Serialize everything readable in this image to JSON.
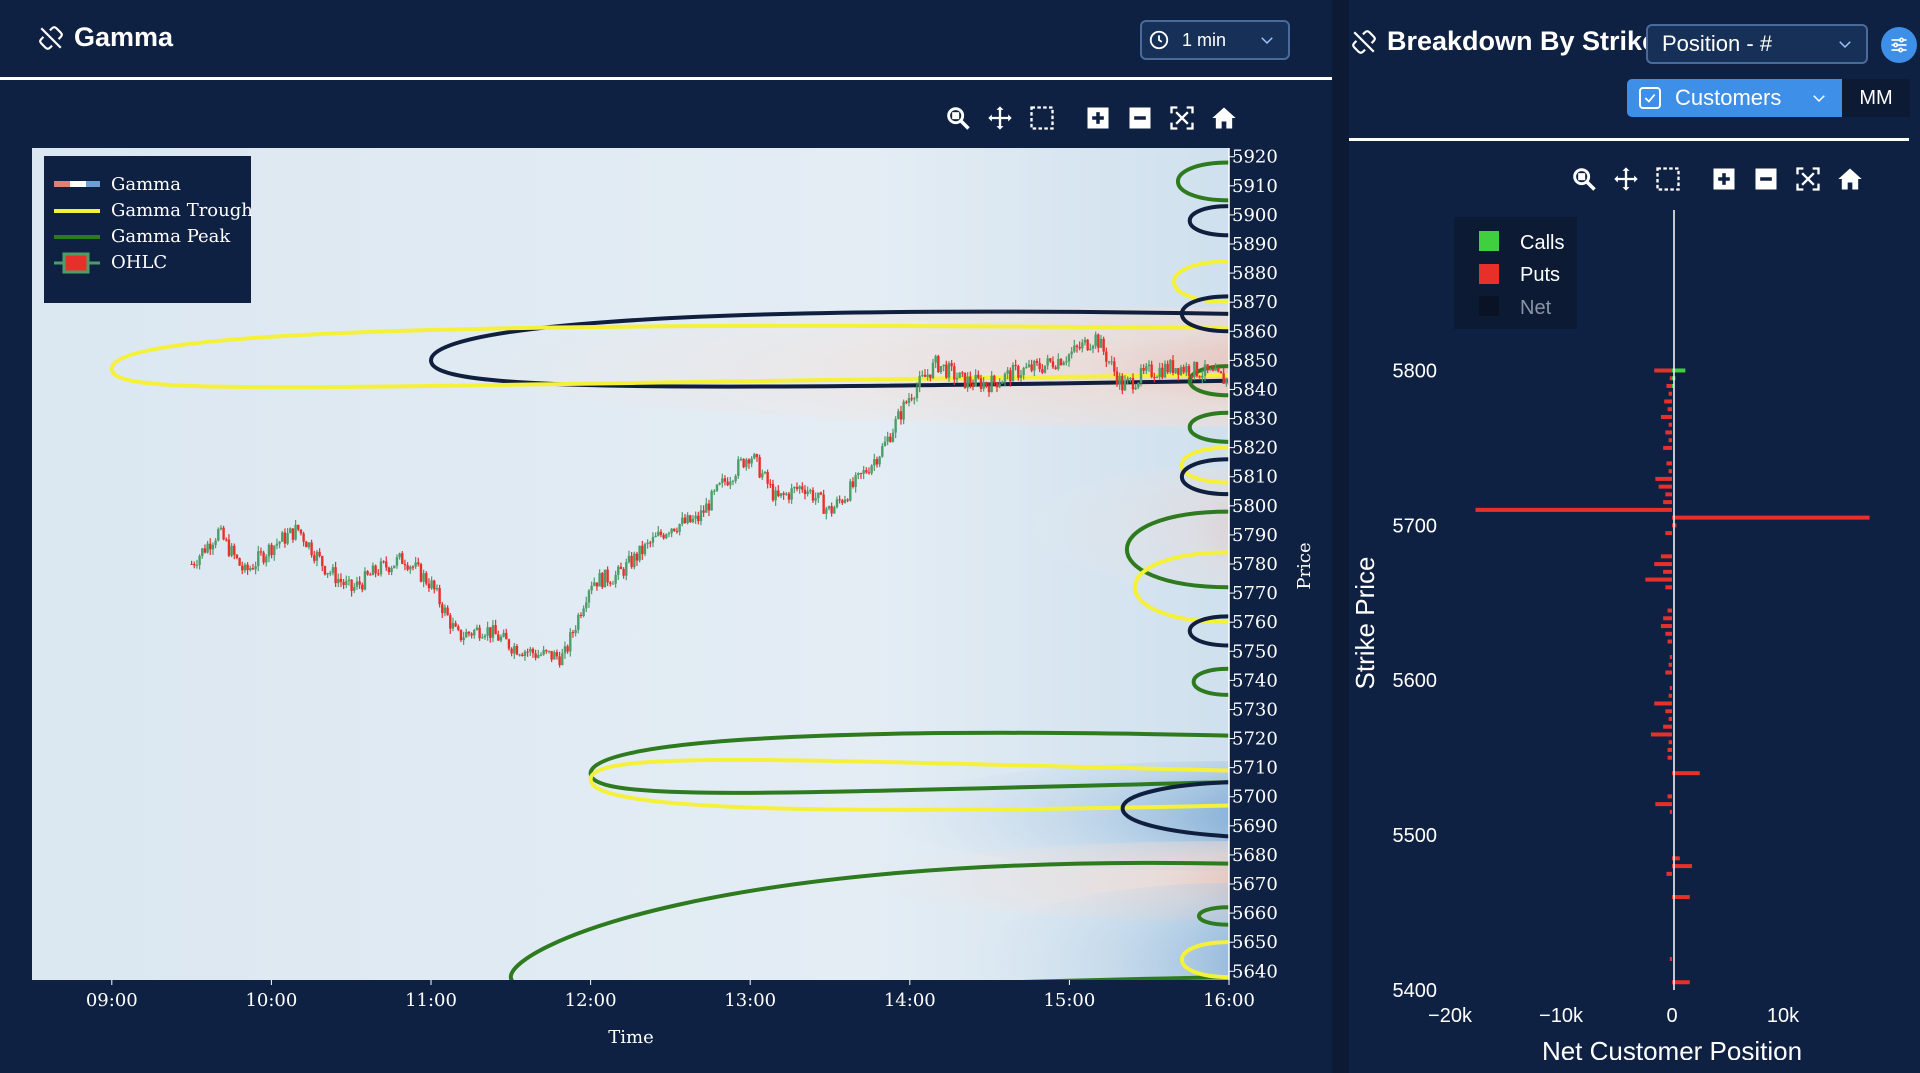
{
  "left": {
    "title": "Gamma",
    "interval": "1 min",
    "icons": [
      "zoom-icon",
      "pan-icon",
      "box-select-icon",
      "zoom-in-icon",
      "zoom-out-icon",
      "autoscale-icon",
      "home-icon"
    ]
  },
  "right": {
    "title": "Breakdown By Strike",
    "position_select": "Position - #",
    "customers_label": "Customers",
    "mm_label": "MM",
    "icons": [
      "zoom-icon",
      "pan-icon",
      "box-select-icon",
      "zoom-in-icon",
      "zoom-out-icon",
      "autoscale-icon",
      "home-icon"
    ]
  },
  "colors": {
    "call": "#3fcf3f",
    "put": "#e8302a",
    "trough": "#f5f13a",
    "peak": "#2e7a1e",
    "gamma_line": "#0f1f3d",
    "panel": "#0f2142"
  },
  "chart_data": [
    {
      "type": "heatmap",
      "xlabel": "Time",
      "ylabel": "Price",
      "x_ticks": [
        "09:00",
        "10:00",
        "11:00",
        "12:00",
        "13:00",
        "14:00",
        "15:00",
        "16:00"
      ],
      "y_ticks": [
        5920,
        5910,
        5900,
        5890,
        5880,
        5870,
        5860,
        5850,
        5840,
        5830,
        5820,
        5810,
        5800,
        5790,
        5780,
        5770,
        5760,
        5750,
        5740,
        5730,
        5720,
        5710,
        5700,
        5690,
        5680,
        5670,
        5660,
        5650,
        5640
      ],
      "ylim": [
        5637,
        5923
      ],
      "legend": [
        "Gamma",
        "Gamma Trough",
        "Gamma Peak",
        "OHLC"
      ],
      "legend_position": "top-left",
      "price_series": {
        "times": [
          "09:30",
          "09:40",
          "09:50",
          "10:00",
          "10:10",
          "10:20",
          "10:30",
          "10:40",
          "10:50",
          "11:00",
          "11:10",
          "11:20",
          "11:30",
          "11:40",
          "11:50",
          "12:00",
          "12:10",
          "12:20",
          "12:30",
          "12:40",
          "12:50",
          "13:00",
          "13:10",
          "13:20",
          "13:30",
          "13:40",
          "13:50",
          "14:00",
          "14:10",
          "14:20",
          "14:30",
          "14:40",
          "14:50",
          "15:00",
          "15:10",
          "15:20",
          "15:30",
          "15:40",
          "15:50",
          "16:00"
        ],
        "close": [
          5780,
          5791,
          5777,
          5786,
          5792,
          5779,
          5771,
          5778,
          5782,
          5773,
          5755,
          5758,
          5752,
          5749,
          5748,
          5774,
          5776,
          5785,
          5793,
          5795,
          5808,
          5818,
          5802,
          5807,
          5798,
          5808,
          5820,
          5838,
          5849,
          5843,
          5842,
          5846,
          5848,
          5852,
          5858,
          5841,
          5846,
          5848,
          5846,
          5843
        ]
      },
      "gamma_contours": [
        {
          "kind": "gamma",
          "apex": [
            "11:00",
            5850
          ],
          "range": [
            5843,
            5866
          ]
        },
        {
          "kind": "trough",
          "apex": [
            "09:00",
            5847
          ],
          "range": [
            5845,
            5861
          ]
        },
        {
          "kind": "peak",
          "apex": [
            "12:00",
            5708
          ],
          "range": [
            5705,
            5721
          ]
        },
        {
          "kind": "trough",
          "apex": [
            "12:00",
            5706
          ],
          "range": [
            5697,
            5709
          ]
        },
        {
          "kind": "gamma",
          "apex": [
            "15:20",
            5696
          ],
          "range": [
            5688,
            5703
          ]
        },
        {
          "kind": "peak",
          "apex": [
            "11:30",
            5638
          ],
          "range": [
            5638,
            5677
          ]
        }
      ]
    },
    {
      "type": "bar",
      "orientation": "horizontal",
      "xlabel": "Net Customer Position",
      "ylabel": "Strike Price",
      "xlim": [
        -20000,
        20000
      ],
      "x_ticks": [
        "−20k",
        "−10k",
        "0",
        "10k"
      ],
      "ylim": [
        5400,
        5810
      ],
      "y_ticks": [
        5800,
        5700,
        5600,
        5500,
        5400
      ],
      "legend": [
        "Calls",
        "Puts",
        "Net"
      ],
      "legend_position": "top-left",
      "strikes": [
        5800,
        5795,
        5790,
        5785,
        5780,
        5775,
        5770,
        5765,
        5760,
        5755,
        5750,
        5745,
        5740,
        5735,
        5730,
        5725,
        5720,
        5715,
        5710,
        5705,
        5700,
        5695,
        5690,
        5685,
        5680,
        5675,
        5670,
        5665,
        5660,
        5655,
        5650,
        5645,
        5640,
        5635,
        5630,
        5625,
        5620,
        5615,
        5610,
        5605,
        5600,
        5595,
        5590,
        5585,
        5580,
        5575,
        5570,
        5565,
        5560,
        5555,
        5550,
        5545,
        5540,
        5535,
        5530,
        5525,
        5520,
        5515,
        5510,
        5505,
        5500,
        5495,
        5490,
        5485,
        5480,
        5475,
        5470,
        5465,
        5460,
        5455,
        5450,
        5445,
        5440,
        5435,
        5430,
        5425,
        5420,
        5415,
        5410,
        5405
      ],
      "series": [
        {
          "name": "Calls",
          "values": [
            1200,
            300,
            200,
            0,
            0,
            0,
            0,
            0,
            0,
            0,
            0,
            0,
            0,
            0,
            0,
            0,
            0,
            0,
            0,
            0,
            0,
            0,
            0,
            0,
            0,
            0,
            0,
            0,
            0,
            0,
            0,
            0,
            0,
            0,
            0,
            0,
            0,
            0,
            0,
            0,
            0,
            0,
            0,
            0,
            0,
            0,
            0,
            0,
            0,
            0,
            0,
            0,
            0,
            0,
            0,
            0,
            0,
            0,
            0,
            0,
            0,
            0,
            0,
            0,
            0,
            0,
            0,
            0,
            0,
            0,
            0,
            0,
            0,
            0,
            0,
            0,
            0,
            0,
            0,
            0
          ]
        },
        {
          "name": "Puts",
          "values": [
            -1600,
            -200,
            -500,
            -300,
            -700,
            -400,
            -1000,
            -300,
            -600,
            -300,
            -800,
            0,
            -500,
            -300,
            -1500,
            -1200,
            -600,
            -800,
            -17700,
            17800,
            400,
            -600,
            0,
            0,
            -1000,
            -1600,
            -800,
            -2400,
            -600,
            0,
            0,
            -400,
            -800,
            -1000,
            -600,
            -400,
            0,
            -200,
            -300,
            -600,
            0,
            -200,
            -300,
            -1600,
            -600,
            -300,
            -800,
            -1900,
            -300,
            -400,
            -400,
            0,
            2500,
            0,
            0,
            -400,
            -1500,
            -200,
            0,
            0,
            0,
            0,
            0,
            700,
            1800,
            -500,
            0,
            0,
            1600,
            0,
            0,
            0,
            0,
            0,
            0,
            0,
            -200,
            0,
            0,
            1600
          ]
        }
      ]
    }
  ]
}
